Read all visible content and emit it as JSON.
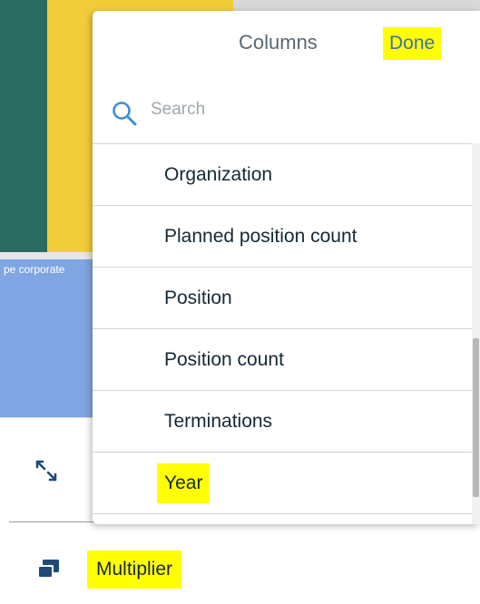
{
  "background": {
    "bar_label": "pe corporate"
  },
  "columns_panel": {
    "title": "Columns",
    "done_label": "Done",
    "search": {
      "placeholder": "Search",
      "value": ""
    },
    "items": [
      {
        "label": "Organization",
        "highlighted": false
      },
      {
        "label": "Planned position count",
        "highlighted": false
      },
      {
        "label": "Position",
        "highlighted": false
      },
      {
        "label": "Position count",
        "highlighted": false
      },
      {
        "label": "Terminations",
        "highlighted": false
      },
      {
        "label": "Year",
        "highlighted": true
      }
    ]
  },
  "toolbar": {
    "multiplier_label": "Multiplier"
  },
  "colors": {
    "highlight": "#ffff00",
    "teal": "#2c6b61",
    "yellow": "#f2cd3a",
    "blue": "#7fa6e2",
    "accent": "#3d70b2"
  },
  "icons": {
    "search": "search-icon",
    "expand": "expand-icon",
    "multiplier": "multiplier-icon"
  }
}
